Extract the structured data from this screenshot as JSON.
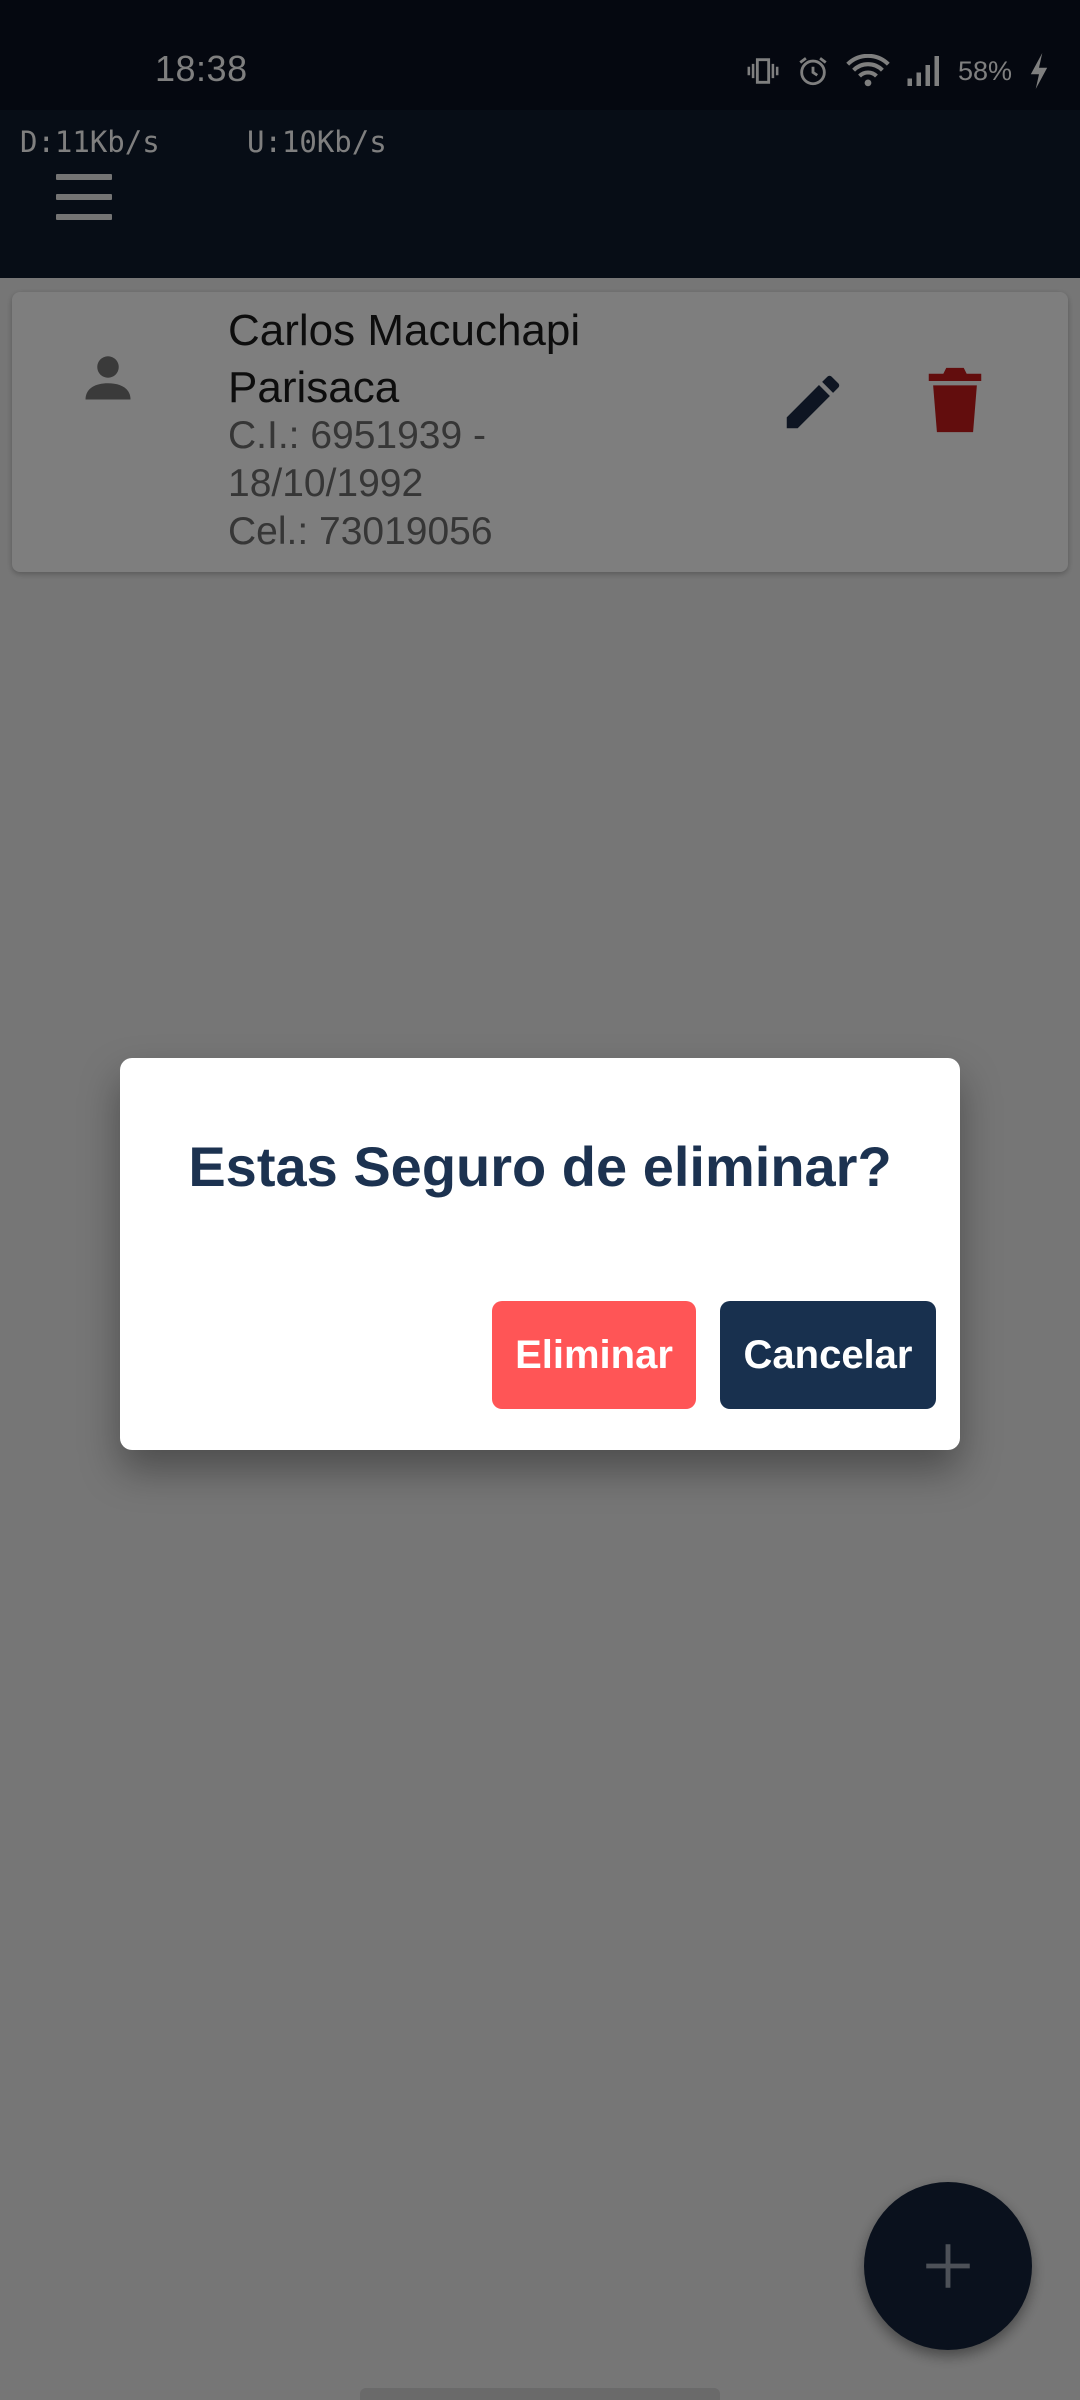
{
  "status_bar": {
    "time": "18:38",
    "battery_percent": "58%",
    "icons": [
      "vibrate-icon",
      "alarm-icon",
      "wifi-icon",
      "signal-icon",
      "charging-icon"
    ]
  },
  "app_bar": {
    "download_speed": "D:11Kb/s",
    "upload_speed": "U:10Kb/s",
    "menu_icon": "menu-icon"
  },
  "contacts": [
    {
      "name": "Carlos  Macuchapi Parisaca",
      "ci_line": "C.I.: 6951939 -",
      "birth_date": "18/10/1992",
      "phone_line": "Cel.: 73019056",
      "avatar_icon": "person-icon",
      "edit_icon": "pencil-icon",
      "delete_icon": "trash-icon"
    }
  ],
  "dialog": {
    "title": "Estas Seguro de eliminar?",
    "confirm_label": "Eliminar",
    "cancel_label": "Cancelar"
  },
  "fab": {
    "icon": "plus-icon"
  },
  "colors": {
    "status_bar_bg": "#0a1020",
    "app_bar_bg": "#0e1a2c",
    "dialog_title": "#1c3250",
    "confirm_button": "#ff5556",
    "cancel_button": "#18304e",
    "delete_icon": "#c41b1b",
    "edit_icon": "#1c2b45",
    "fab_bg": "#14233a"
  }
}
